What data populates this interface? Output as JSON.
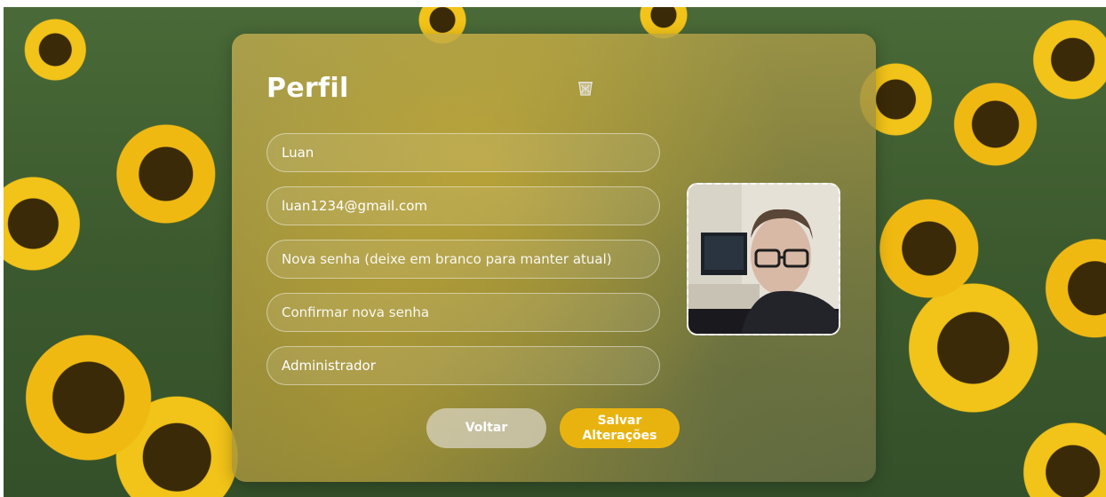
{
  "page": {
    "title": "Perfil",
    "trash_icon": "trash-icon"
  },
  "form": {
    "name_value": "Luan",
    "email_value": "luan1234@gmail.com",
    "new_password_placeholder": "Nova senha (deixe em branco para manter atual)",
    "confirm_password_placeholder": "Confirmar nova senha",
    "role_value": "Administrador"
  },
  "buttons": {
    "back_label": "Voltar",
    "save_label": "Salvar Alterações"
  },
  "colors": {
    "accent": "#e9b30f",
    "card_tint": "#b4a450",
    "text": "#ffffff"
  }
}
